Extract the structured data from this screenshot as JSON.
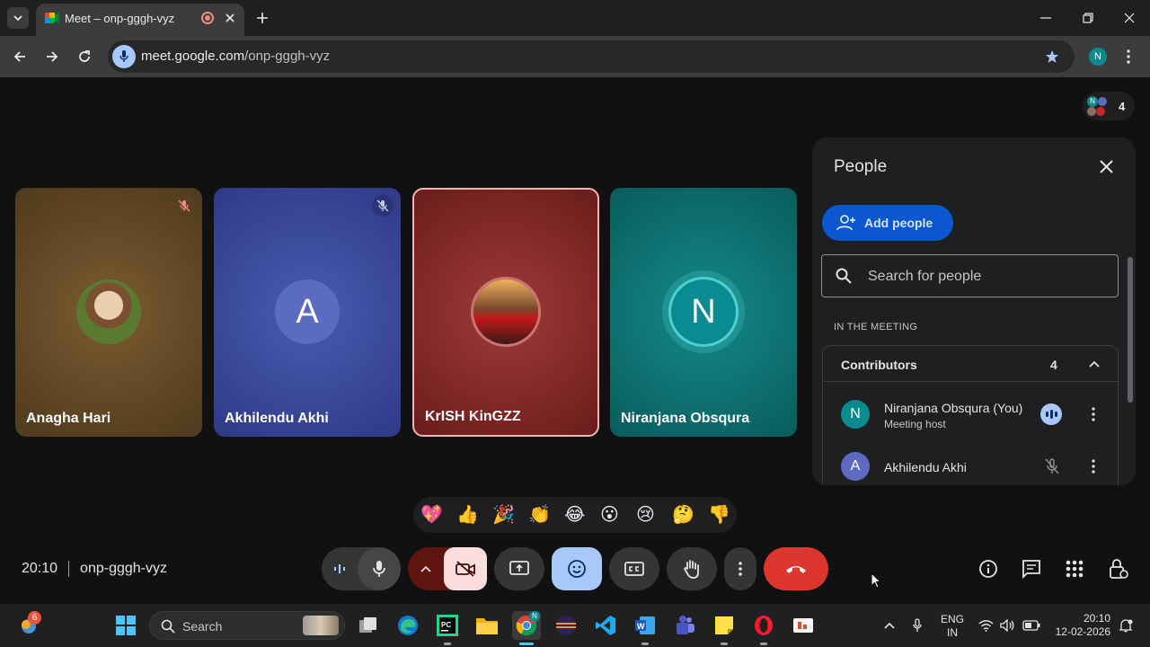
{
  "browser": {
    "tab_title": "Meet – onp-gggh-vyz",
    "url_host": "meet.google.com",
    "url_path": "/onp-gggh-vyz",
    "profile_initial": "N"
  },
  "meeting": {
    "participant_count": "4",
    "time": "20:10",
    "code": "onp-gggh-vyz"
  },
  "tiles": [
    {
      "name": "Anagha Hari",
      "muted": true
    },
    {
      "name": "Akhilendu Akhi",
      "avatar_letter": "A",
      "muted": true
    },
    {
      "name": "KrISH KinGZZ",
      "muted": false
    },
    {
      "name": "Niranjana Obsqura",
      "avatar_letter": "N",
      "muted": false
    }
  ],
  "people_panel": {
    "title": "People",
    "add_people_label": "Add people",
    "search_placeholder": "Search for people",
    "section_label": "IN THE MEETING",
    "group_label": "Contributors",
    "group_count": "4",
    "members": [
      {
        "initial": "N",
        "name": "Niranjana Obsqura (You)",
        "role": "Meeting host",
        "color": "#0b8a8f"
      },
      {
        "initial": "A",
        "name": "Akhilendu Akhi",
        "role": "",
        "color": "#5c6bc0"
      }
    ]
  },
  "reactions": [
    "💖",
    "👍",
    "🎉",
    "👏",
    "😂",
    "😮",
    "😢",
    "🤔",
    "👎"
  ],
  "taskbar": {
    "search_label": "Search",
    "notification_badge": "6",
    "lang_top": "ENG",
    "lang_bottom": "IN",
    "clock_time": "20:10",
    "clock_date": "12-02-2026"
  },
  "colors": {
    "accent_blue": "#a8c7fa",
    "end_call_red": "#dc362e",
    "add_people_bg": "#0b57d0",
    "camera_off_bg": "#f9dedc"
  }
}
